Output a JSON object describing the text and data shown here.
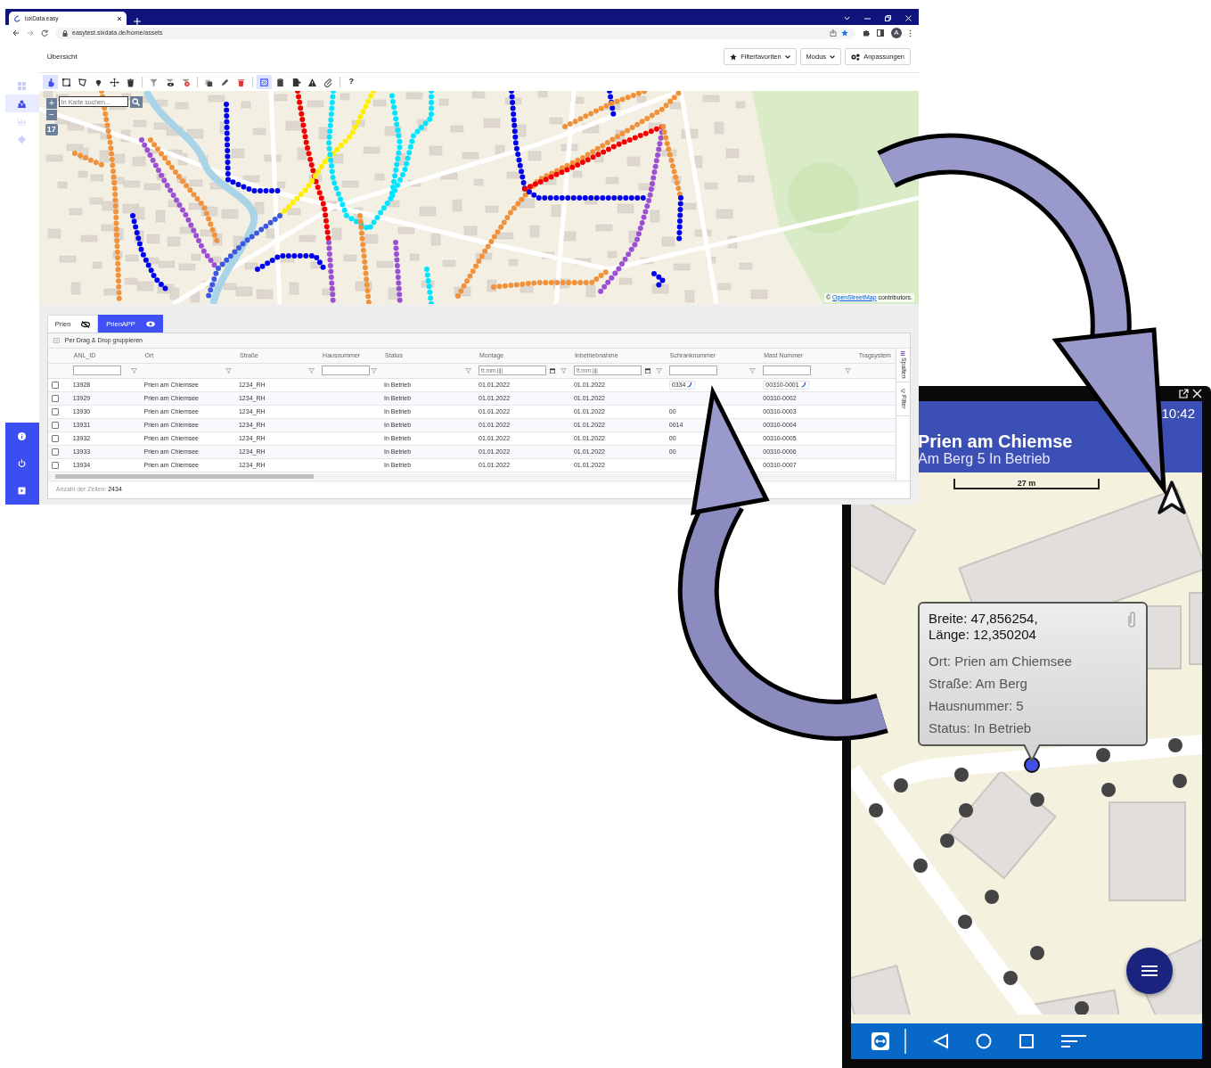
{
  "browser": {
    "tab_title": "luxData.easy",
    "address": "easytest.sixdata.de/home/assets",
    "avatar": "A"
  },
  "sidebar": {
    "items": [
      {
        "selected": false
      },
      {
        "selected": true
      },
      {
        "selected": false
      },
      {
        "selected": false
      }
    ]
  },
  "header": {
    "title": "Übersicht",
    "buttons": [
      {
        "label": "Filterfavoriten",
        "dropdown": true
      },
      {
        "label": "Modus",
        "dropdown": true
      },
      {
        "label": "Anpassungen",
        "dropdown": false
      }
    ]
  },
  "toolbar": {
    "groups": [
      [
        {
          "selected": true
        },
        {
          "selected": false
        },
        {
          "selected": false
        },
        {
          "selected": false
        },
        {
          "selected": false
        },
        {
          "selected": false
        }
      ],
      [
        {
          "selected": false
        },
        {
          "selected": false
        },
        {
          "selected": false
        }
      ],
      [
        {
          "selected": false
        },
        {
          "selected": false
        },
        {
          "selected": false
        }
      ],
      [
        {
          "selected": true
        },
        {
          "selected": false
        },
        {
          "selected": false
        },
        {
          "selected": false
        },
        {
          "selected": false
        }
      ]
    ],
    "help": "?"
  },
  "map": {
    "search": {
      "placeholder": "In Karte suchen..."
    },
    "zoom_in": "+",
    "zoom_out": "−",
    "zoom_level": "17",
    "attribution": {
      "prefix": "©",
      "link": "OpenStreetMap",
      "suffix": "contributors."
    }
  },
  "grid": {
    "tabs": [
      {
        "label": "Prien",
        "selected": false,
        "visible": false
      },
      {
        "label": "PrienAPP",
        "selected": true,
        "visible": true
      }
    ],
    "group_bar": "Per Drag & Drop gruppieren",
    "columns": [
      "ANL_ID",
      "Ort",
      "Straße",
      "Hausnummer",
      "Status",
      "Montage",
      "Inbetriebnahme",
      "Schranknummer",
      "Mast Nummer",
      "Tragsystem"
    ],
    "filters": [
      {
        "kind": "text"
      },
      {
        "kind": "button"
      },
      {
        "kind": "button"
      },
      {
        "kind": "text"
      },
      {
        "kind": "button"
      },
      {
        "kind": "date",
        "placeholder": "tt.mm.jjjj"
      },
      {
        "kind": "date",
        "placeholder": "tt.mm.jjjj"
      },
      {
        "kind": "text"
      },
      {
        "kind": "text"
      },
      {
        "kind": "blank"
      }
    ],
    "rows": [
      {
        "checked": false,
        "cells": [
          "13928",
          "Prien am Chiemsee",
          "1234_RH",
          null,
          "In Betrieb",
          "01.01.2022",
          "01.01.2022",
          "0334",
          "00310-0001",
          null
        ],
        "schrank_phone": true,
        "mast_phone": true
      },
      {
        "checked": false,
        "cells": [
          "13929",
          "Prien am Chiemsee",
          "1234_RH",
          null,
          "In Betrieb",
          "01.01.2022",
          "01.01.2022",
          null,
          "00310-0002",
          null
        ],
        "schrank_phone": false,
        "mast_phone": false
      },
      {
        "checked": false,
        "cells": [
          "13930",
          "Prien am Chiemsee",
          "1234_RH",
          null,
          "In Betrieb",
          "01.01.2022",
          "01.01.2022",
          "00",
          "00310-0003",
          null
        ],
        "schrank_phone": false,
        "mast_phone": false
      },
      {
        "checked": false,
        "cells": [
          "13931",
          "Prien am Chiemsee",
          "1234_RH",
          null,
          "In Betrieb",
          "01.01.2022",
          "01.01.2022",
          "0014",
          "00310-0004",
          null
        ],
        "schrank_phone": false,
        "mast_phone": false
      },
      {
        "checked": false,
        "cells": [
          "13932",
          "Prien am Chiemsee",
          "1234_RH",
          null,
          "In Betrieb",
          "01.01.2022",
          "01.01.2022",
          "00",
          "00310-0005",
          null
        ],
        "schrank_phone": false,
        "mast_phone": false
      },
      {
        "checked": false,
        "cells": [
          "13933",
          "Prien am Chiemsee",
          "1234_RH",
          null,
          "In Betrieb",
          "01.01.2022",
          "01.01.2022",
          "00",
          "00310-0006",
          null
        ],
        "schrank_phone": false,
        "mast_phone": false
      },
      {
        "checked": false,
        "cells": [
          "13934",
          "Prien am Chiemsee",
          "1234_RH",
          null,
          "In Betrieb",
          "01.01.2022",
          "01.01.2022",
          null,
          "00310-0007",
          null
        ],
        "schrank_phone": false,
        "mast_phone": false
      }
    ],
    "side_tabs": [
      "Spalten",
      "Filter"
    ],
    "footer": "Anzahl der Zeilen: **2434**"
  },
  "phone": {
    "time": "10:42",
    "title": "Prien am Chiemse",
    "subtitle": "Am Berg 5 In Betrieb",
    "scale": "27 m",
    "popup": {
      "heading": [
        "Breite: 47,856254,",
        "Länge: 12,350204"
      ],
      "lines": [
        "Ort: Prien am Chiemsee",
        "Straße: Am Berg",
        "Hausnummer: 5",
        "Status: In Betrieb"
      ]
    }
  }
}
